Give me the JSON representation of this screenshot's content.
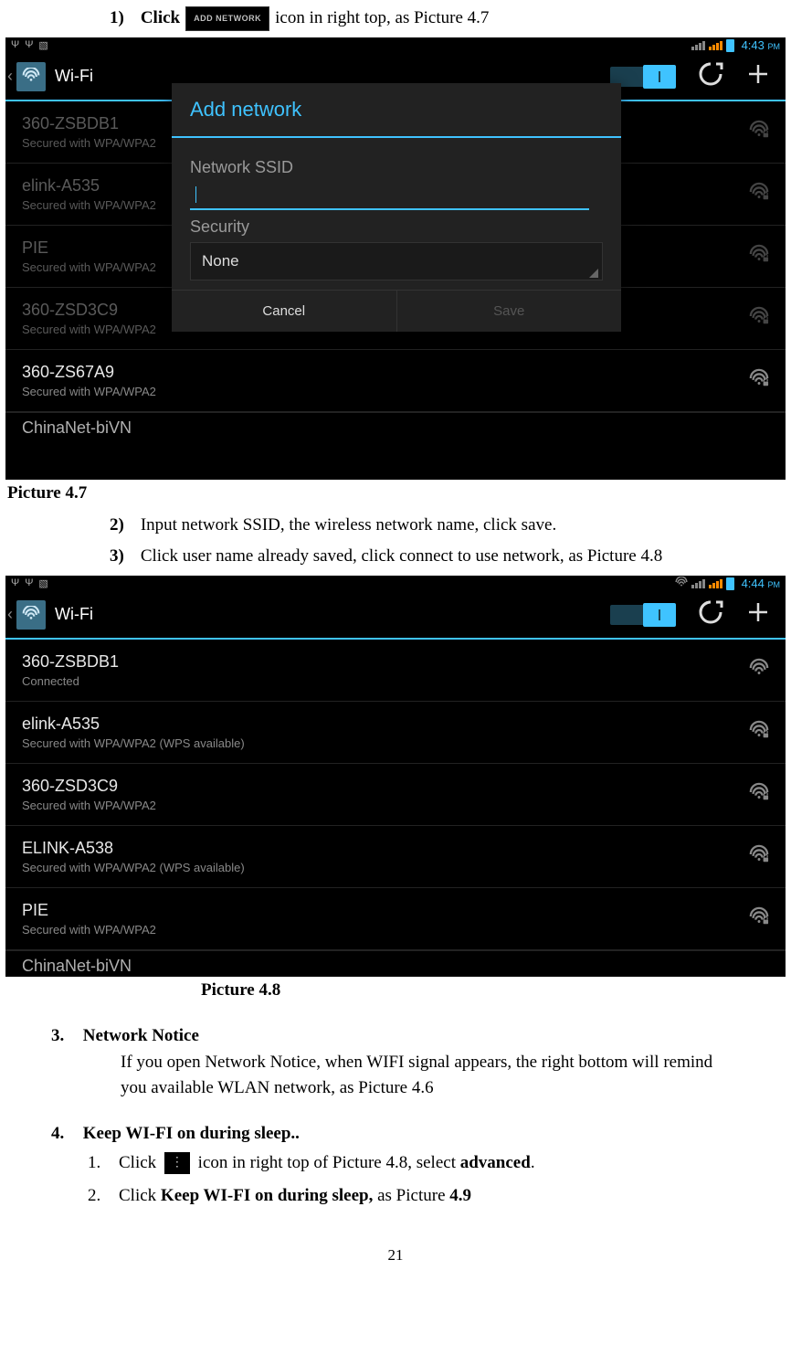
{
  "instr1": {
    "num": "1)",
    "prefix": "Click",
    "badge": "ADD NETWORK",
    "suffix": "icon in right top, as Picture 4.7"
  },
  "screenshot1": {
    "status": {
      "time": "4:43",
      "pm": "PM"
    },
    "title": "Wi-Fi",
    "toggle_state": "ON",
    "networks": [
      {
        "name": "360-ZSBDB1",
        "sec": "Secured with WPA/WPA2",
        "dim": true
      },
      {
        "name": "elink-A535",
        "sec": "Secured with WPA/WPA2",
        "dim": true
      },
      {
        "name": "PIE",
        "sec": "Secured with WPA/WPA2",
        "dim": true
      },
      {
        "name": "360-ZSD3C9",
        "sec": "Secured with WPA/WPA2",
        "dim": true
      },
      {
        "name": "360-ZS67A9",
        "sec": "Secured with WPA/WPA2",
        "dim": false
      }
    ],
    "cut": "ChinaNet-biVN",
    "dialog": {
      "title": "Add network",
      "field_label": "Network SSID",
      "sec_label": "Security",
      "sec_value": "None",
      "cancel": "Cancel",
      "save": "Save"
    }
  },
  "caption1": "Picture 4.7",
  "instr2": {
    "num": "2)",
    "text": "Input network SSID, the wireless network name, click save."
  },
  "instr3": {
    "num": "3)",
    "text": "Click user name already saved, click connect to use network, as Picture 4.8"
  },
  "screenshot2": {
    "status": {
      "time": "4:44",
      "pm": "PM"
    },
    "title": "Wi-Fi",
    "networks": [
      {
        "name": "360-ZSBDB1",
        "sec": "Connected"
      },
      {
        "name": "elink-A535",
        "sec": "Secured with WPA/WPA2 (WPS available)"
      },
      {
        "name": "360-ZSD3C9",
        "sec": "Secured with WPA/WPA2"
      },
      {
        "name": "ELINK-A538",
        "sec": "Secured with WPA/WPA2 (WPS available)"
      },
      {
        "name": "PIE",
        "sec": "Secured with WPA/WPA2"
      }
    ],
    "cut": "ChinaNet-biVN"
  },
  "caption2": "Picture 4.8",
  "section3": {
    "num": "3.",
    "title": "Network Notice",
    "body": "If you open Network Notice, when WIFI signal appears, the right bottom will remind you available WLAN network, as Picture 4.6"
  },
  "section4": {
    "num": "4.",
    "title": "Keep WI-FI on during sleep.."
  },
  "sub1": {
    "num": "1.",
    "prefix": "Click",
    "suffix_a": "icon in right top of Picture 4.8, select ",
    "bold": "advanced",
    "suffix_b": "."
  },
  "sub2": {
    "num": "2.",
    "prefix": "Click ",
    "bold1": "Keep WI-FI on during sleep,",
    "mid": " as Picture ",
    "bold2": "4.9"
  },
  "pagenum": "21"
}
